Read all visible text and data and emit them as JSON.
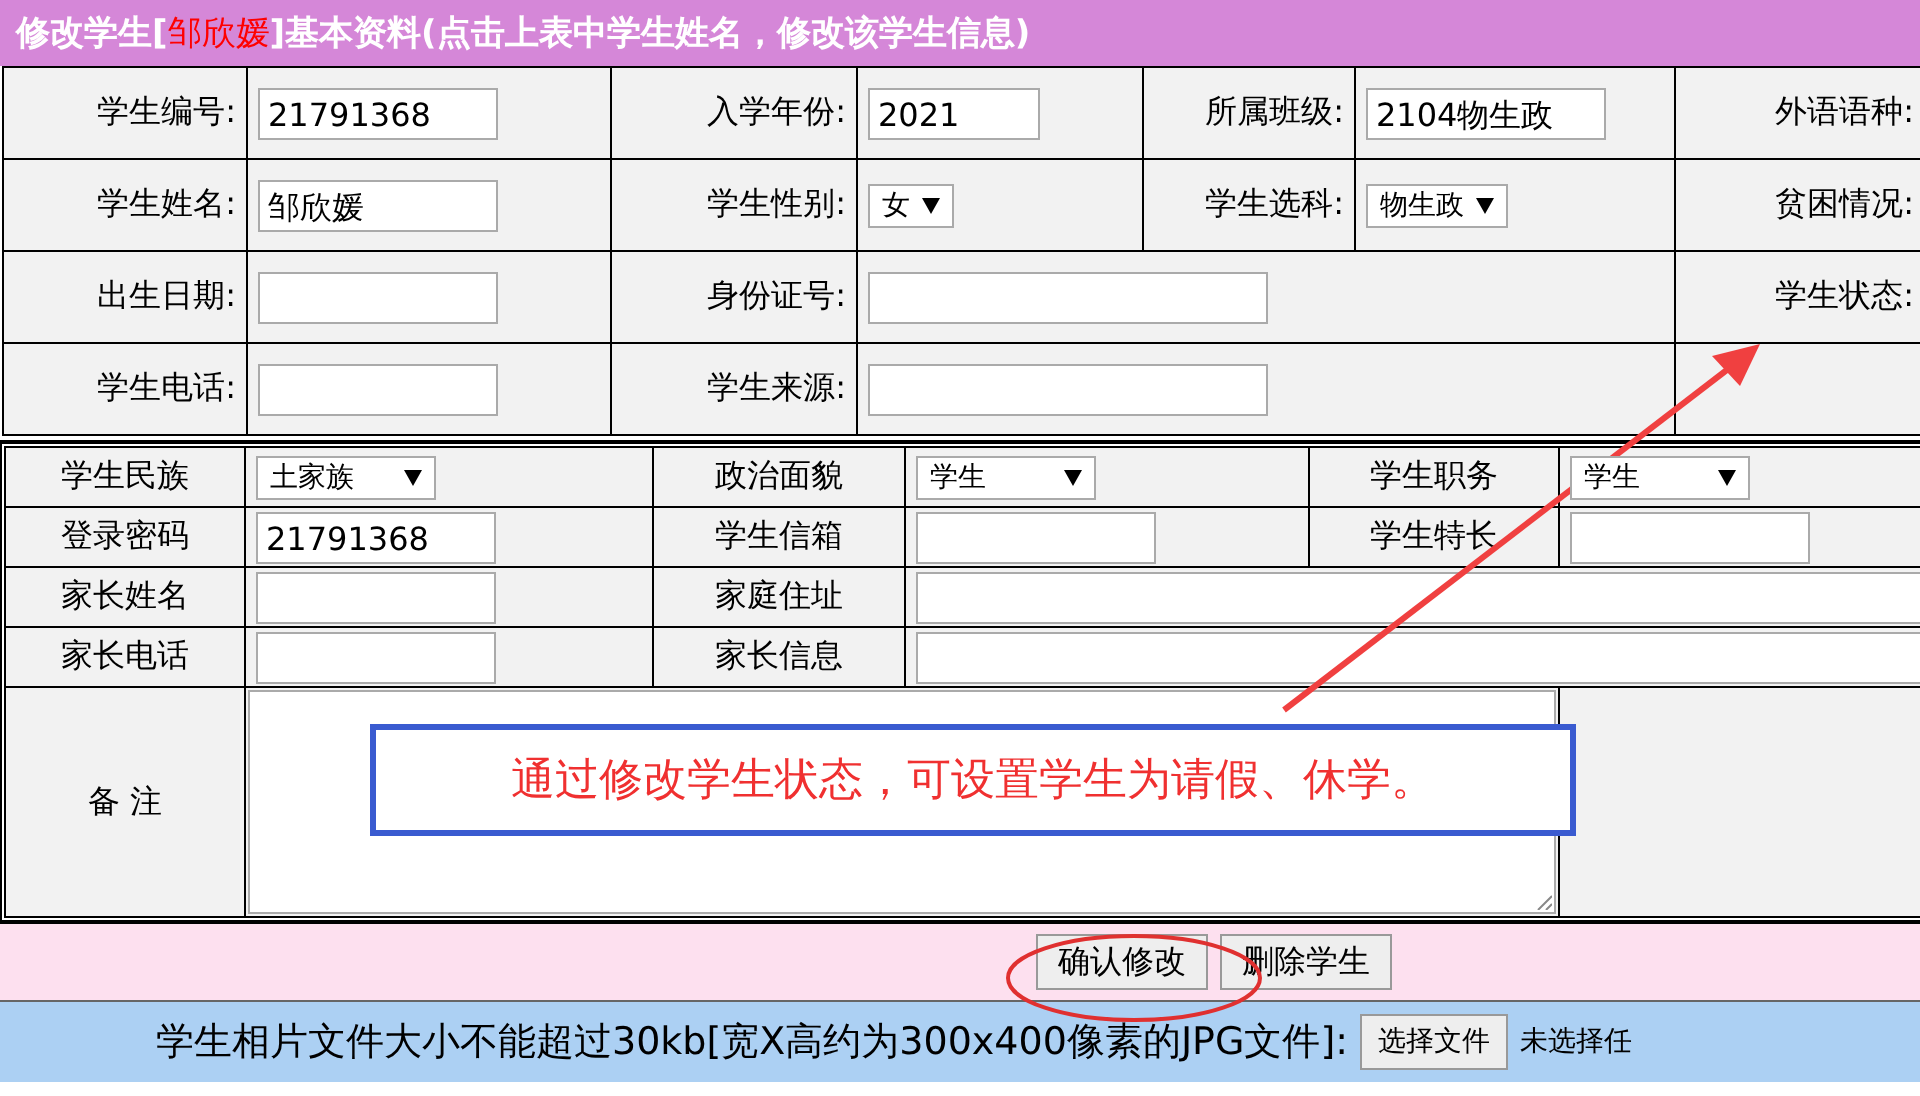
{
  "header": {
    "before": "修改学生[",
    "name": "邹欣媛",
    "after": "]基本资料(点击上表中学生姓名，修改该学生信息)"
  },
  "basic_table": [
    [
      {
        "kind": "label",
        "text": "学生编号:"
      },
      {
        "kind": "input",
        "value": "21791368"
      },
      {
        "kind": "label",
        "text": "入学年份:"
      },
      {
        "kind": "short_input",
        "value": "2021"
      },
      {
        "kind": "label",
        "text": "所属班级:"
      },
      {
        "kind": "input",
        "value": "2104物生政"
      },
      {
        "kind": "label",
        "text": "外语语种:"
      }
    ],
    [
      {
        "kind": "label",
        "text": "学生姓名:"
      },
      {
        "kind": "input",
        "value": "邹欣媛"
      },
      {
        "kind": "label",
        "text": "学生性别:"
      },
      {
        "kind": "select",
        "value": "女"
      },
      {
        "kind": "label",
        "text": "学生选科:"
      },
      {
        "kind": "select",
        "value": "物生政"
      },
      {
        "kind": "label",
        "text": "贫困情况:"
      }
    ],
    [
      {
        "kind": "label",
        "text": "出生日期:"
      },
      {
        "kind": "input"
      },
      {
        "kind": "label",
        "text": "身份证号:"
      },
      {
        "kind": "wide_input"
      },
      {
        "kind": "label",
        "text": "学生状态:"
      }
    ],
    [
      {
        "kind": "label",
        "text": "学生电话:"
      },
      {
        "kind": "input"
      },
      {
        "kind": "label",
        "text": "学生来源:"
      },
      {
        "kind": "wide_input"
      },
      {
        "kind": "empty"
      }
    ]
  ],
  "detail_table": [
    [
      {
        "kind": "label",
        "text": "学生民族"
      },
      {
        "kind": "select",
        "value": "土家族"
      },
      {
        "kind": "label",
        "text": "政治面貌"
      },
      {
        "kind": "select",
        "value": "学生"
      },
      {
        "kind": "label",
        "text": "学生职务"
      },
      {
        "kind": "select",
        "value": "学生"
      }
    ],
    [
      {
        "kind": "label",
        "text": "登录密码"
      },
      {
        "kind": "input",
        "value": "21791368"
      },
      {
        "kind": "label",
        "text": "学生信箱"
      },
      {
        "kind": "input"
      },
      {
        "kind": "label",
        "text": "学生特长"
      },
      {
        "kind": "input"
      }
    ],
    [
      {
        "kind": "label",
        "text": "家长姓名"
      },
      {
        "kind": "input"
      },
      {
        "kind": "label",
        "text": "家庭住址"
      },
      {
        "kind": "wide_input"
      }
    ],
    [
      {
        "kind": "label",
        "text": "家长电话"
      },
      {
        "kind": "input"
      },
      {
        "kind": "label",
        "text": "家长信息"
      },
      {
        "kind": "wide_input"
      }
    ]
  ],
  "remark": {
    "label": "备 注"
  },
  "callout": "通过修改学生状态，可设置学生为请假、休学。",
  "buttons": [
    {
      "label": "确认修改",
      "highlighted": true
    },
    {
      "label": "删除学生",
      "highlighted": false
    }
  ],
  "photo": {
    "text": "学生相片文件大小不能超过30kb[宽X高约为300x400像素的JPG文件]:",
    "button": "选择文件",
    "status": "未选择任"
  }
}
